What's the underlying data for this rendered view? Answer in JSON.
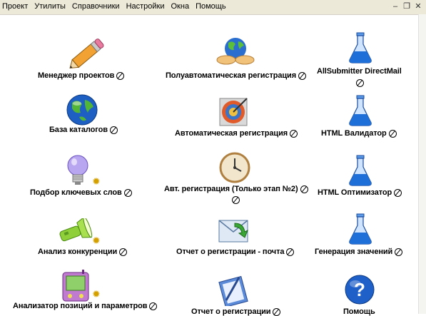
{
  "menu": [
    "Проект",
    "Утилиты",
    "Справочники",
    "Настройки",
    "Окна",
    "Помощь"
  ],
  "controls": {
    "minimize": "‒",
    "restore": "❐",
    "close": "✕"
  },
  "tools": {
    "project_manager": "Менеджер проектов",
    "semi_auto_reg": "Полуавтоматическая регистрация",
    "allsubmitter_dm": "AllSubmitter DirectMail",
    "catalog_db": "База каталогов",
    "auto_reg": "Автоматическая регистрация",
    "html_validator": "HTML Валидатор",
    "keywords": "Подбор ключевых слов",
    "auto_reg_stage2": "Авт. регистрация (Только этап №2)",
    "html_optimizer": "HTML Оптимизатор",
    "competitors": "Анализ конкуренции",
    "reg_report_mail": "Отчет о регистрации - почта",
    "value_gen": "Генерация значений",
    "position_analyzer": "Анализатор позиций и параметров",
    "reg_report": "Отчет о регистрации",
    "help": "Помощь"
  },
  "colors": {
    "menubar": "#ece9d8",
    "flask": "#1f6fd8"
  }
}
